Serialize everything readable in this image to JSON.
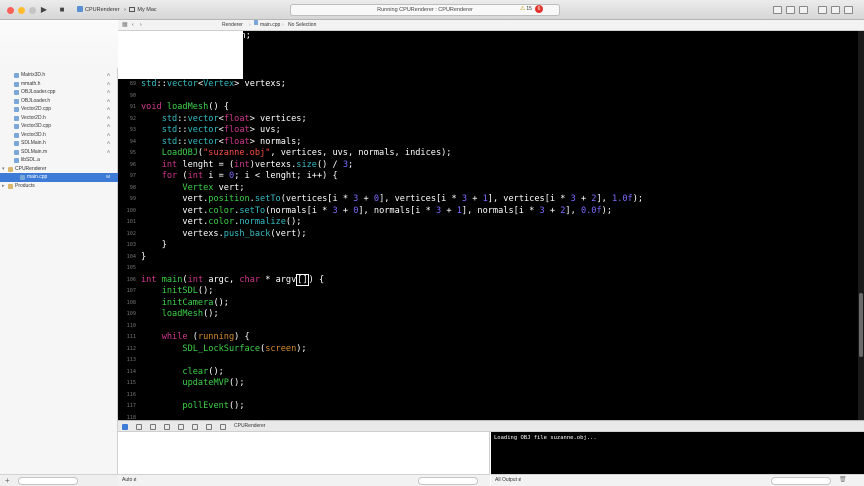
{
  "toolbar": {
    "scheme_target": "CPURenderer",
    "scheme_device": "My Mac",
    "activity": "Running CPURenderer : CPURenderer",
    "warning_count": "15",
    "error_count": "6"
  },
  "navigator": {
    "items": [
      {
        "label": "Matrix3D.h",
        "status": "A",
        "indent": 1
      },
      {
        "label": "mmath.h",
        "status": "A",
        "indent": 1
      },
      {
        "label": "OBJLoader.cpp",
        "status": "A",
        "indent": 1
      },
      {
        "label": "OBJLoader.h",
        "status": "A",
        "indent": 1
      },
      {
        "label": "Vector2D.cpp",
        "status": "A",
        "indent": 1
      },
      {
        "label": "Vector2D.h",
        "status": "A",
        "indent": 1
      },
      {
        "label": "Vector3D.cpp",
        "status": "A",
        "indent": 1
      },
      {
        "label": "Vector3D.h",
        "status": "A",
        "indent": 1
      },
      {
        "label": "SDLMain.h",
        "status": "A",
        "indent": 1
      },
      {
        "label": "SDLMain.m",
        "status": "A",
        "indent": 1
      },
      {
        "label": "libSDL.a",
        "status": "",
        "indent": 1
      },
      {
        "label": "CPURenderer",
        "status": "",
        "indent": 0
      },
      {
        "label": "main.cpp",
        "status": "M",
        "indent": 2,
        "selected": true
      },
      {
        "label": "Products",
        "status": "",
        "indent": 0
      }
    ]
  },
  "jumpbar": {
    "parts": [
      "Renderer",
      "main.cpp",
      "No Selection"
    ]
  },
  "editor": {
    "line_numbers": [
      "89",
      "90",
      "91",
      "92",
      "93",
      "94",
      "95",
      "96",
      "97",
      "98",
      "99",
      "100",
      "101",
      "102",
      "103",
      "104",
      "105",
      "106",
      "107",
      "108",
      "109",
      "110",
      "111",
      "112",
      "113",
      "114",
      "115",
      "116",
      "117",
      "118"
    ],
    "partial_lines": [
      "tion;",
      "r;"
    ]
  },
  "debug": {
    "target": "CPURenderer",
    "console_output": "Loading OBJ file suzanne.obj...",
    "variables_filter": "Auto ≢",
    "console_filter": "All Output ≢"
  }
}
